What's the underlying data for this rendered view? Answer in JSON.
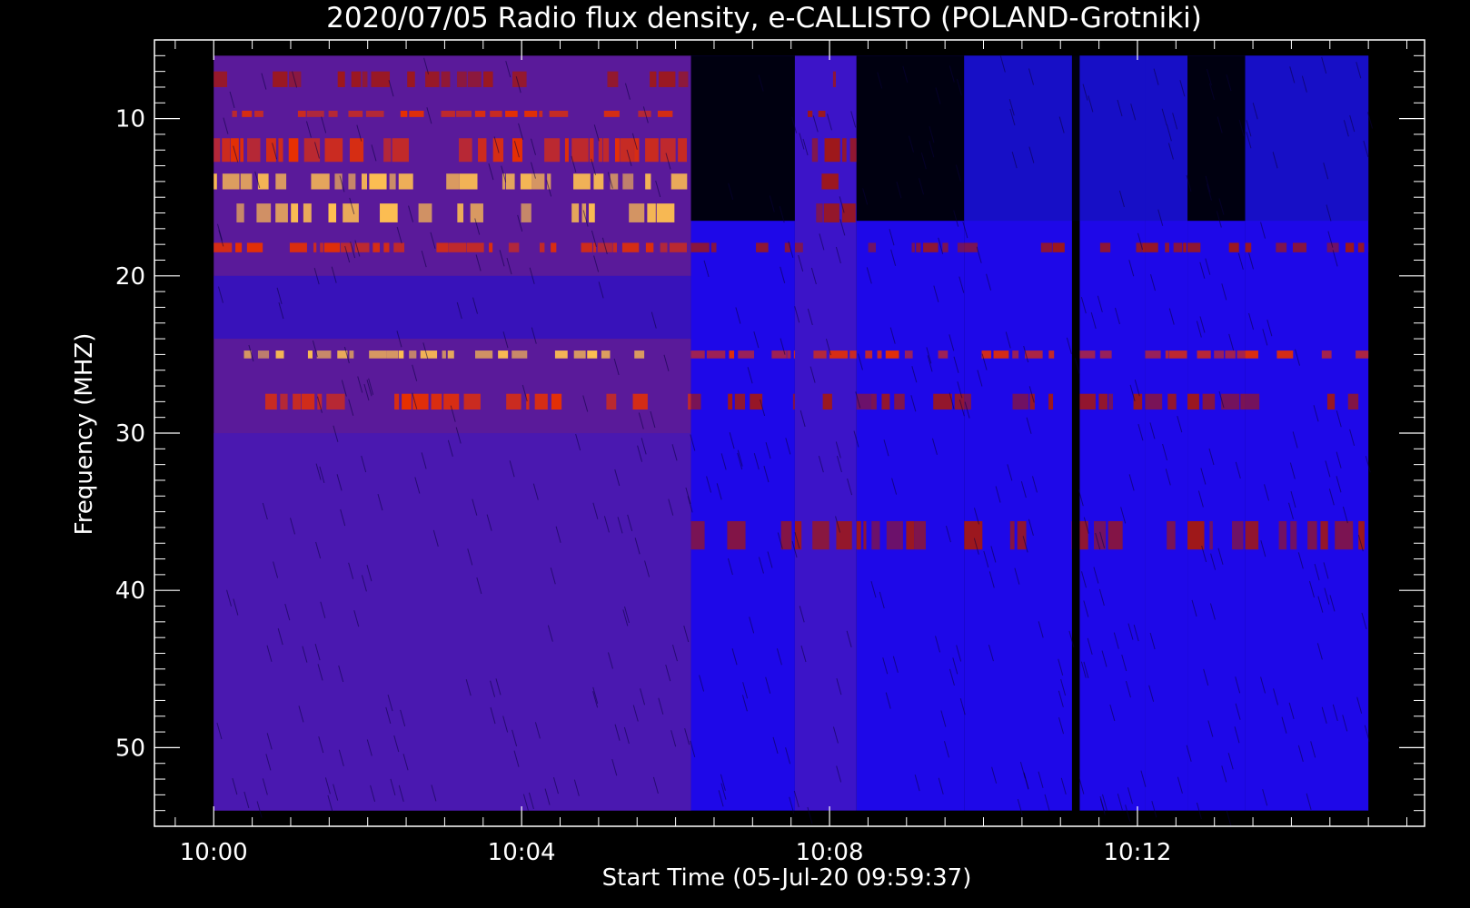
{
  "chart_data": {
    "type": "heatmap",
    "title": "2020/07/05  Radio flux density, e-CALLISTO (POLAND-Grotniki)",
    "xlabel": "Start Time (05-Jul-20 09:59:37)",
    "ylabel": "Frequency (MHZ)",
    "xticks": [
      "10:00",
      "10:04",
      "10:08",
      "10:12"
    ],
    "x_tick_minutes": [
      0,
      4,
      8,
      12
    ],
    "xlim_minutes": [
      -0.77,
      15.73
    ],
    "data_time_range_minutes": [
      0.0,
      15.0
    ],
    "yticks": [
      10,
      20,
      30,
      40,
      50
    ],
    "ylim": [
      5,
      55
    ],
    "data_freq_range_mhz": [
      6,
      54
    ],
    "y_reversed": true,
    "colormap": "blue-red-yellow",
    "colors": {
      "background": "#000000",
      "low": "#1a00d8",
      "mid": "#8a1010",
      "high": "#ff3a00",
      "peak": "#ffe070"
    },
    "time_segments": [
      {
        "start_min": 0.0,
        "end_min": 6.2,
        "level": "high"
      },
      {
        "start_min": 6.2,
        "end_min": 7.55,
        "level": "low-gapped"
      },
      {
        "start_min": 7.55,
        "end_min": 8.35,
        "level": "mid"
      },
      {
        "start_min": 8.35,
        "end_min": 9.75,
        "level": "low-gapped"
      },
      {
        "start_min": 9.75,
        "end_min": 11.15,
        "level": "low"
      },
      {
        "start_min": 11.15,
        "end_min": 11.25,
        "level": "gap"
      },
      {
        "start_min": 11.25,
        "end_min": 12.1,
        "level": "low"
      },
      {
        "start_min": 12.1,
        "end_min": 12.65,
        "level": "low"
      },
      {
        "start_min": 12.65,
        "end_min": 13.4,
        "level": "low-gapped"
      },
      {
        "start_min": 13.4,
        "end_min": 15.0,
        "level": "low"
      }
    ],
    "bright_bands_mhz": [
      {
        "freq": 7.5,
        "width": 1.0,
        "intensity": "mid"
      },
      {
        "freq": 9.7,
        "width": 0.4,
        "intensity": "high"
      },
      {
        "freq": 12.0,
        "width": 1.5,
        "intensity": "high"
      },
      {
        "freq": 14.0,
        "width": 1.0,
        "intensity": "peak"
      },
      {
        "freq": 16.0,
        "width": 1.2,
        "intensity": "peak"
      },
      {
        "freq": 18.2,
        "width": 0.6,
        "intensity": "high"
      },
      {
        "freq": 25.0,
        "width": 0.5,
        "intensity": "peak"
      },
      {
        "freq": 28.0,
        "width": 1.0,
        "intensity": "high"
      },
      {
        "freq": 36.5,
        "width": 1.8,
        "intensity": "mid"
      }
    ]
  }
}
